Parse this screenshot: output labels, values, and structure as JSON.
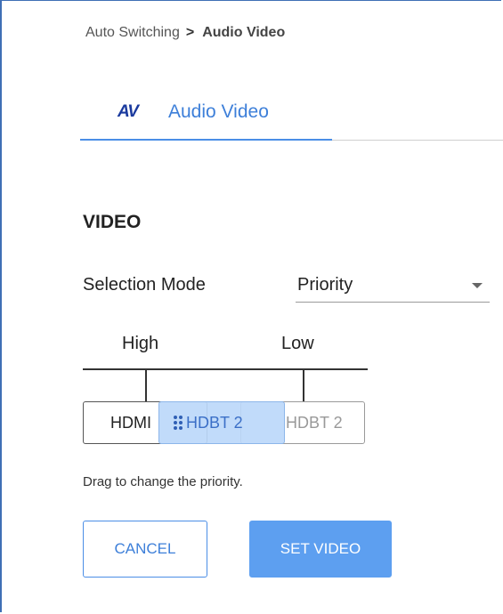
{
  "breadcrumb": {
    "parent": "Auto Switching",
    "separator": ">",
    "current": "Audio Video"
  },
  "tab": {
    "icon_text": "AV",
    "label": "Audio Video"
  },
  "section": {
    "title": "VIDEO"
  },
  "selection_mode": {
    "label": "Selection Mode",
    "value": "Priority"
  },
  "priority": {
    "high_label": "High",
    "low_label": "Low",
    "chips": [
      {
        "label": "HDMI"
      },
      {
        "label": "HDBT 2"
      }
    ],
    "dragging_label": "HDBT 2",
    "hint": "Drag to change the priority."
  },
  "buttons": {
    "cancel": "CANCEL",
    "set_video": "SET VIDEO"
  },
  "colors": {
    "accent": "#3d7fd9",
    "primary_button": "#5d9ff0",
    "drag_highlight": "#bcd8fa",
    "frame_border": "#3f6fb5"
  }
}
